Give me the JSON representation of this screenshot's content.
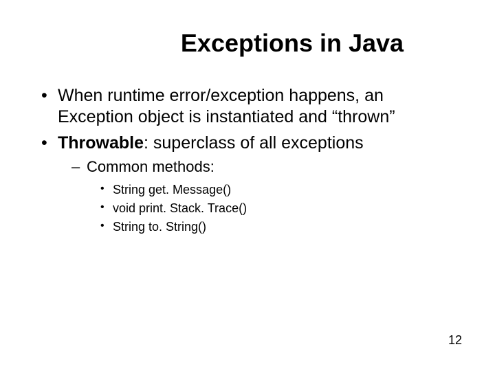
{
  "title": "Exceptions in Java",
  "bullets": {
    "b1": "When runtime error/exception happens, an Exception object is instantiated and “thrown”",
    "b2_bold": "Throwable",
    "b2_rest": ": superclass of all exceptions",
    "sub1": "Common methods:",
    "m1": "String get. Message()",
    "m2": "void print. Stack. Trace()",
    "m3": "String to. String()"
  },
  "page_number": "12"
}
